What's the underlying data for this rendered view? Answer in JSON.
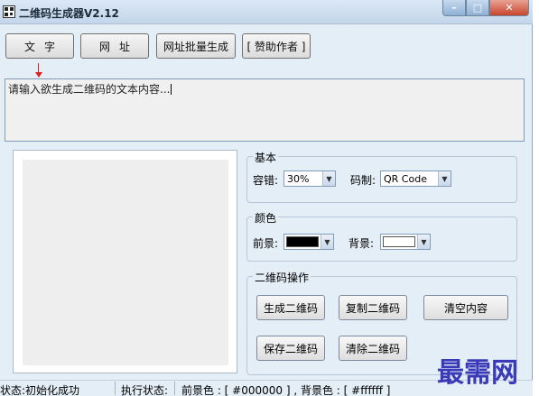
{
  "window": {
    "title": "二维码生成器V2.12",
    "controls": {
      "minimize": "–",
      "maximize": "□",
      "close": "✕"
    }
  },
  "toolbar": {
    "text_label": "文字",
    "url_label": "网址",
    "batch_label": "网址批量生成",
    "donate_label": "[ 赞助作者 ]"
  },
  "input": {
    "value": "请输入欲生成二维码的文本内容..."
  },
  "basic": {
    "title": "基本",
    "error_label": "容错:",
    "error_value": "30%",
    "code_label": "码制:",
    "code_value": "QR Code"
  },
  "color": {
    "title": "颜色",
    "fg_label": "前景:",
    "fg_color": "#000000",
    "bg_label": "背景:",
    "bg_color": "#ffffff"
  },
  "ops": {
    "title": "二维码操作",
    "generate": "生成二维码",
    "copy": "复制二维码",
    "clear_content": "清空内容",
    "save": "保存二维码",
    "clear_qr": "清除二维码"
  },
  "status": {
    "state": "状态:初始化成功",
    "exec": "执行状态:",
    "colors": "前景色 : [ #000000 ] , 背景色 : [ #ffffff ]"
  },
  "watermark": "最需网"
}
